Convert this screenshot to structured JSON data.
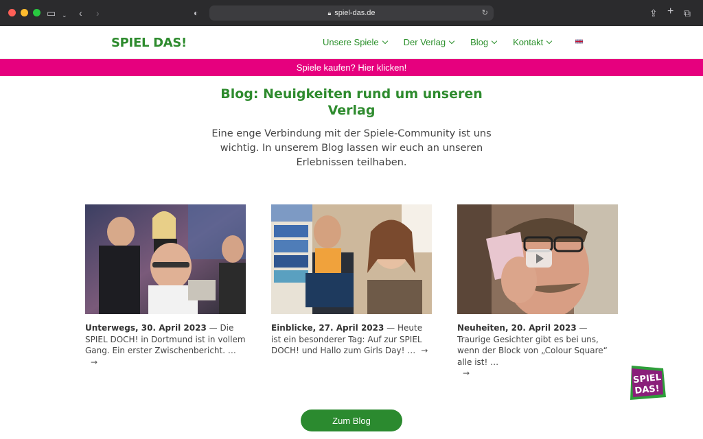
{
  "browser": {
    "url": "spiel-das.de"
  },
  "header": {
    "logo": "SPIEL DAS!",
    "nav": [
      {
        "label": "Unsere Spiele"
      },
      {
        "label": "Der Verlag"
      },
      {
        "label": "Blog"
      },
      {
        "label": "Kontakt"
      }
    ]
  },
  "promo": {
    "label": "Spiele kaufen? Hier klicken!"
  },
  "main": {
    "title": "Blog: Neuigkeiten rund um unseren Verlag",
    "intro": "Eine enge Verbindung mit der Spiele-Community ist uns wichtig. In unserem Blog lassen wir euch an unseren Erlebnissen teilhaben.",
    "posts": [
      {
        "heading": "Unterwegs, 30. April 2023",
        "excerpt": " — Die SPIEL DOCH! in Dortmund ist in vollem Gang. Ein erster Zwischenbericht. …",
        "arrow": "→"
      },
      {
        "heading": "Einblicke, 27. April 2023",
        "excerpt": " — Heute ist ein besonderer Tag: Auf zur SPIEL DOCH! und Hallo zum Girls Day! …",
        "arrow": "→"
      },
      {
        "heading": "Neuheiten, 20. April 2023",
        "excerpt": " — Traurige Gesichter gibt es bei uns, wenn der Block von „Colour Square“ alle ist! …",
        "arrow": "→"
      }
    ],
    "cta_label": "Zum Blog",
    "badge_text": "SPIEL DAS!"
  }
}
